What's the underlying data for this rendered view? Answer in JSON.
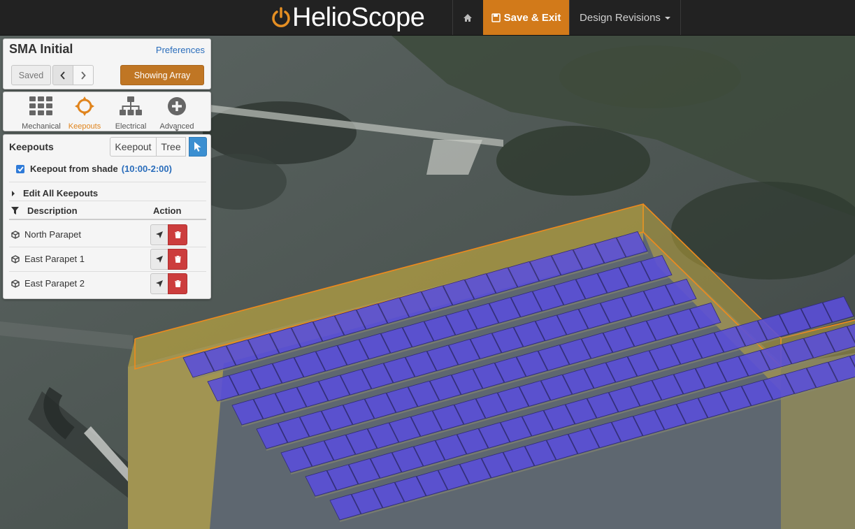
{
  "nav": {
    "brand": "HelioScope",
    "save_exit_label": "Save & Exit",
    "design_revisions_label": "Design Revisions"
  },
  "header": {
    "design_name": "SMA Initial",
    "preferences_label": "Preferences",
    "saved_label": "Saved",
    "showing_array_label": "Showing Array"
  },
  "tools": [
    {
      "label": "Mechanical",
      "icon": "grid-icon"
    },
    {
      "label": "Keepouts",
      "icon": "crosshair-icon",
      "active": true
    },
    {
      "label": "Electrical",
      "icon": "hierarchy-icon"
    },
    {
      "label": "Advanced",
      "icon": "plus-circle-icon"
    }
  ],
  "keepouts": {
    "title": "Keepouts",
    "keepout_button": "Keepout",
    "tree_button": "Tree",
    "shade_checkbox_label": "Keepout from shade",
    "shade_checked": true,
    "shade_time": "(10:00-2:00)",
    "edit_all_label": "Edit All Keepouts",
    "columns": [
      "Description",
      "Action"
    ],
    "rows": [
      {
        "name": "North Parapet"
      },
      {
        "name": "East Parapet 1"
      },
      {
        "name": "East Parapet 2"
      }
    ]
  },
  "colors": {
    "accent": "#d27a1a",
    "nav_bg": "#222222",
    "panel_module": "#5a4fd8",
    "keepout_fill": "#d8b93a",
    "keepout_outline": "#f08a1c",
    "delete": "#cc3d3d",
    "select_active": "#3b8fd1"
  }
}
